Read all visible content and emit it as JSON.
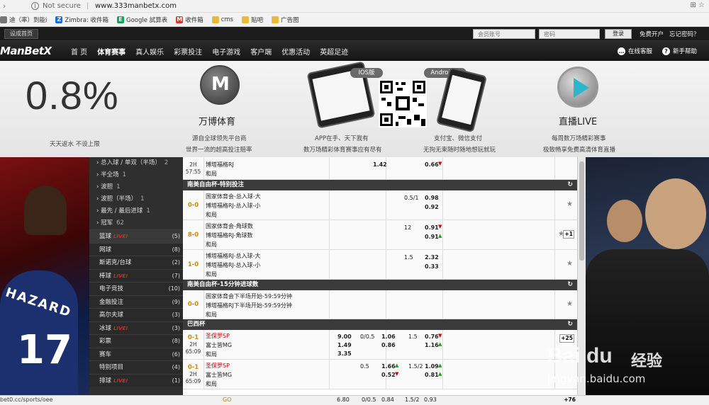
{
  "browser": {
    "nav_glyph": "›",
    "security_label": "Not secure",
    "separator": "|",
    "url": "www.333manbetx.com",
    "right_icons": "⊞ ☆"
  },
  "bookmarks": [
    {
      "label": "迪（率）到能i",
      "icon": "",
      "color": "#777"
    },
    {
      "label": "Zimbra: 收件箱",
      "icon": "Z",
      "color": "#1e6bd6"
    },
    {
      "label": "Google 試算表",
      "icon": "E",
      "color": "#1a9e5a"
    },
    {
      "label": "收件箱",
      "icon": "M",
      "color": "#d23b2e"
    },
    {
      "label": "cms",
      "icon": "",
      "color": "#e8b93a"
    },
    {
      "label": "贴吧",
      "icon": "",
      "color": "#e8b93a"
    },
    {
      "label": "广告图",
      "icon": "",
      "color": "#e8b93a"
    }
  ],
  "site_top": {
    "home_label": "设成首页",
    "username_placeholder": "会员账号",
    "password_placeholder": "密码",
    "login_label": "登录",
    "signup_label": "免费开户",
    "forgot_label": "忘记密码？"
  },
  "mainnav": {
    "logo": "ManBetX",
    "items": [
      "首 页",
      "体育赛事",
      "真人娱乐",
      "彩票投注",
      "电子游戏",
      "客户端",
      "优惠活动",
      "英超足迹"
    ],
    "support_label": "在线客服",
    "help_label": "新手帮助",
    "help_icon": "?",
    "support_icon": "…"
  },
  "banner": {
    "rebate": "0.8%",
    "rebate_sub": "天天返水 不设上限",
    "brand_title": "万博体育",
    "brand_sub1": "源自全球领先平台商",
    "brand_sub2": "世界一流的超高投注赔率",
    "ios_label": "IOS版",
    "android_label": "Android版",
    "app_sub1": "APP在手、天下我有",
    "app_sub2": "数万场精彩体育赛事应有尽有",
    "pay_sub1": "支付宝、微信支付",
    "pay_sub2": "无拘无束随时随地想玩就玩",
    "live_title": "直播LIVE",
    "live_sub1": "每周数万场精彩赛事",
    "live_sub2": "极致畅享免费高清体育直播",
    "wb_icon_text": "M"
  },
  "left_art": {
    "jersey_name": "HAZARD",
    "jersey_number": "17"
  },
  "sidebar": {
    "subitems": [
      {
        "label": "› 总入球 / 单双（半场）",
        "count": "2"
      },
      {
        "label": "› 半全场",
        "count": "1"
      },
      {
        "label": "› 波胆",
        "count": "1"
      },
      {
        "label": "› 波胆（半场）",
        "count": "1"
      },
      {
        "label": "› 最先 / 最后进球",
        "count": "1"
      },
      {
        "label": "› 冠军",
        "count": "62"
      }
    ],
    "categories": [
      {
        "label": "篮球",
        "live": "LIVE!",
        "count": "(5)"
      },
      {
        "label": "网球",
        "live": "",
        "count": "(8)"
      },
      {
        "label": "斯诺克/台球",
        "live": "",
        "count": "(2)"
      },
      {
        "label": "棒球",
        "live": "LIVE!",
        "count": "(7)"
      },
      {
        "label": "电子竞技",
        "live": "",
        "count": "(10)"
      },
      {
        "label": "金融投注",
        "live": "",
        "count": "(9)"
      },
      {
        "label": "高尔夫球",
        "live": "",
        "count": "(3)"
      },
      {
        "label": "冰球",
        "live": "LIVE!",
        "count": "(3)"
      },
      {
        "label": "彩票",
        "live": "",
        "count": "(8)"
      },
      {
        "label": "赛车",
        "live": "",
        "count": "(6)"
      },
      {
        "label": "特别项目",
        "live": "",
        "count": "(4)"
      },
      {
        "label": "排球",
        "live": "LIVE!",
        "count": "(1)"
      }
    ]
  },
  "table": {
    "top_row": {
      "time1": "2H",
      "time2": "57:55",
      "team": "博塔福格RJ",
      "draw": "和局",
      "v1": "1.42",
      "v2": "0.66"
    },
    "league1": {
      "name": "南美自由杯-特别投注",
      "refresh": "↻"
    },
    "rows1": [
      {
        "score": "0-0",
        "t1": "国家体育会-总入球-大",
        "t2": "博塔福格RJ-总入球-小",
        "draw": "和局",
        "hdp": "0.5/1",
        "o1": "0.98",
        "o2": "0.92",
        "star": "★",
        "plus": ""
      },
      {
        "score": "8-0",
        "t1": "国家体育会-角球数",
        "t2": "博塔福格RJ-角球数",
        "draw": "和局",
        "hdp": "12",
        "o1": "0.91",
        "o2": "0.91",
        "star": "★",
        "plus": "+1"
      },
      {
        "score": "1-0",
        "t1": "博塔福格RJ-总入球-大",
        "t2": "博塔福格RJ-总入球-小",
        "draw": "和局",
        "hdp": "1.5",
        "o1": "2.32",
        "o2": "0.33",
        "star": "★",
        "plus": ""
      }
    ],
    "league2": {
      "name": "南美自由杯-15分钟进球数",
      "refresh": "↻"
    },
    "rows2": [
      {
        "score": "0-0",
        "t1": "国家体育会下半场开始-59:59分钟",
        "t2": "博塔福格RJ下半场开始-59:59分钟",
        "draw": "和局",
        "star": "★"
      }
    ],
    "league3": {
      "name": "巴西杯",
      "refresh": "↻"
    },
    "rows3": [
      {
        "score": "0-1",
        "time1": "2H",
        "time2": "65:09",
        "t1": "圣保罗SP",
        "t2": "富士皆MG",
        "draw": "和局",
        "m1": "9.00",
        "m2": "1.49",
        "m3": "3.35",
        "h": "0/0.5",
        "h1": "1.06",
        "h2": "0.86",
        "ou": "1.5",
        "ou1": "0.76",
        "ou2": "1.16",
        "plus": "+25"
      },
      {
        "score": "0-1",
        "time1": "2H",
        "time2": "65:09",
        "t1": "圣保罗SP",
        "t2": "富士皆MG",
        "draw": "和局",
        "h": "0.5",
        "h1": "1.66",
        "h2": "0.52",
        "ou": "1.5/2",
        "ou1": "1.09",
        "ou2": "0.81",
        "plus": ""
      }
    ]
  },
  "statusbar": {
    "url": "bet0.cc/sports/oee",
    "go": "GO",
    "r1": "6.80",
    "r2": "0/0.5",
    "r3": "0.84",
    "r4": "1.5/2",
    "r5": "0.93",
    "r6": "+76"
  },
  "watermark": {
    "brand": "Bai du",
    "brand_cn": "经验",
    "url": "jingyan.baidu.com"
  },
  "colors": {
    "live": "#e0271d",
    "odds_up": "#1aa01a",
    "odds_down": "#d00000",
    "score": "#d08a00"
  }
}
